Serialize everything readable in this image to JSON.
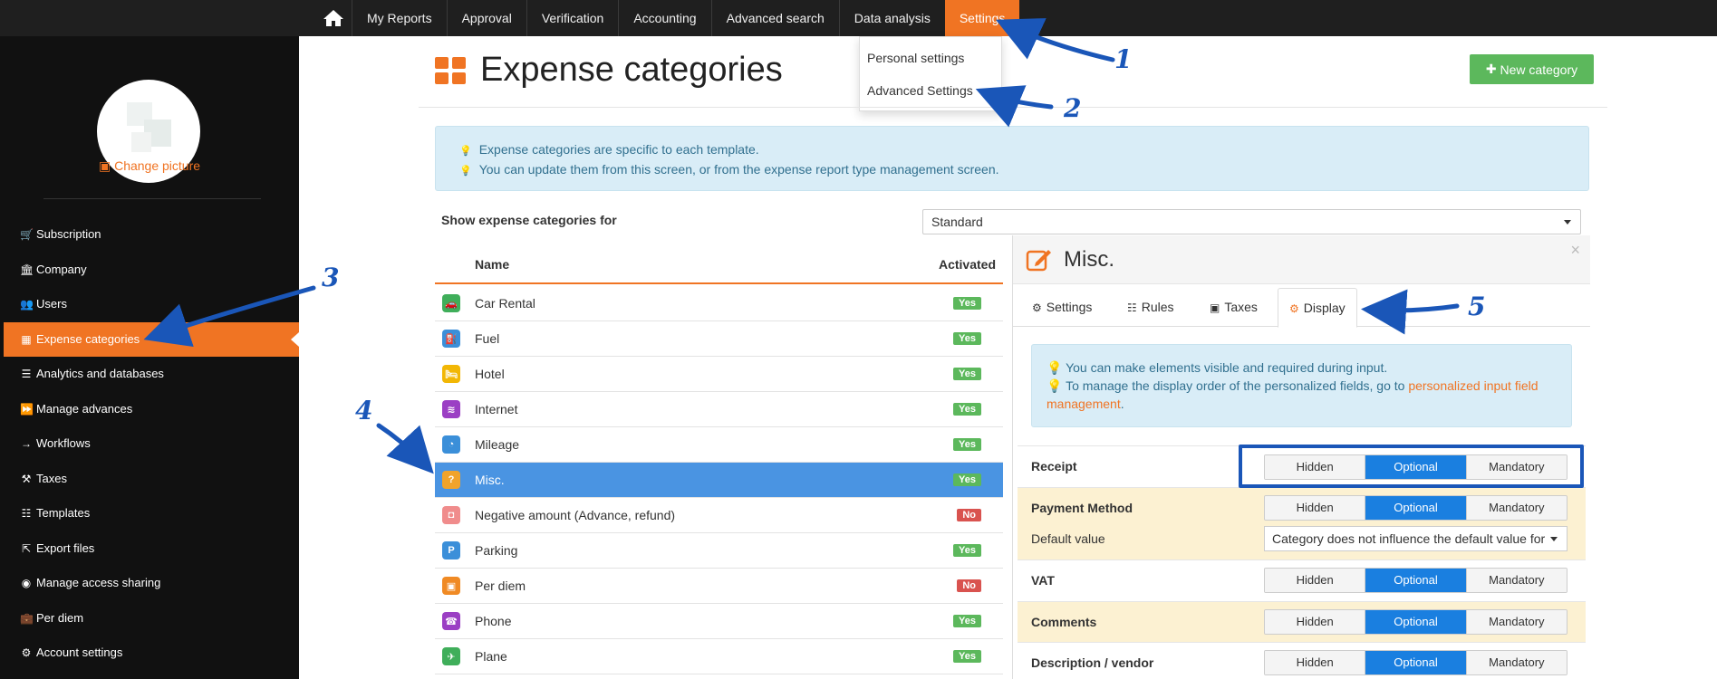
{
  "topnav": {
    "items": [
      "My Reports",
      "Approval",
      "Verification",
      "Accounting",
      "Advanced search",
      "Data analysis",
      "Settings"
    ],
    "active": "Settings",
    "dropdown": [
      "Personal settings",
      "Advanced Settings"
    ]
  },
  "sidebar": {
    "change_picture": "Change picture",
    "items": [
      {
        "label": "Subscription",
        "icon": "cart-icon"
      },
      {
        "label": "Company",
        "icon": "bank-icon"
      },
      {
        "label": "Users",
        "icon": "users-icon"
      },
      {
        "label": "Expense categories",
        "icon": "grid-icon"
      },
      {
        "label": "Analytics and databases",
        "icon": "table-icon"
      },
      {
        "label": "Manage advances",
        "icon": "fast-forward-icon"
      },
      {
        "label": "Workflows",
        "icon": "arrow-right-icon"
      },
      {
        "label": "Taxes",
        "icon": "gavel-icon"
      },
      {
        "label": "Templates",
        "icon": "list-icon"
      },
      {
        "label": "Export files",
        "icon": "export-icon"
      },
      {
        "label": "Manage access sharing",
        "icon": "eye-icon"
      },
      {
        "label": "Per diem",
        "icon": "briefcase-icon"
      },
      {
        "label": "Account settings",
        "icon": "gears-icon"
      }
    ],
    "active": "Expense categories"
  },
  "header": {
    "title": "Expense categories",
    "new_button": "New category"
  },
  "info": {
    "line1": "Expense categories are specific to each template.",
    "line2": "You can update them from this screen, or from the expense report type management screen."
  },
  "filter": {
    "label": "Show expense categories for",
    "value": "Standard"
  },
  "list": {
    "col_name": "Name",
    "col_activated": "Activated",
    "rows": [
      {
        "name": "Car Rental",
        "status": "Yes",
        "color": "#3fae5a",
        "glyph": "🚗"
      },
      {
        "name": "Fuel",
        "status": "Yes",
        "color": "#3b8fd9",
        "glyph": "⛽"
      },
      {
        "name": "Hotel",
        "status": "Yes",
        "color": "#f2b705",
        "glyph": "🛏"
      },
      {
        "name": "Internet",
        "status": "Yes",
        "color": "#9b3fc4",
        "glyph": "≋"
      },
      {
        "name": "Mileage",
        "status": "Yes",
        "color": "#3b8fd9",
        "glyph": "◔"
      },
      {
        "name": "Misc.",
        "status": "Yes",
        "color": "#f0a32a",
        "glyph": "?"
      },
      {
        "name": "Negative amount (Advance, refund)",
        "status": "No",
        "color": "#f08c8c",
        "glyph": "◘"
      },
      {
        "name": "Parking",
        "status": "Yes",
        "color": "#3b8fd9",
        "glyph": "P"
      },
      {
        "name": "Per diem",
        "status": "No",
        "color": "#f08a24",
        "glyph": "▣"
      },
      {
        "name": "Phone",
        "status": "Yes",
        "color": "#9b3fc4",
        "glyph": "☎"
      },
      {
        "name": "Plane",
        "status": "Yes",
        "color": "#3fae5a",
        "glyph": "✈"
      }
    ],
    "selected": "Misc."
  },
  "panel": {
    "title": "Misc.",
    "tabs": [
      "Settings",
      "Rules",
      "Taxes",
      "Display"
    ],
    "active_tab": "Display",
    "info_line1": "You can make elements visible and required during input.",
    "info_line2": "To manage the display order of the personalized fields, go to",
    "info_link": "personalized input field management",
    "info_end": ".",
    "options": [
      "Hidden",
      "Optional",
      "Mandatory"
    ],
    "fields": [
      {
        "label": "Receipt",
        "value": "Optional"
      },
      {
        "label": "Payment Method",
        "value": "Optional"
      },
      {
        "label": "VAT",
        "value": "Optional"
      },
      {
        "label": "Comments",
        "value": "Optional"
      },
      {
        "label": "Description / vendor",
        "value": "Optional"
      }
    ],
    "default_label": "Default value",
    "default_value": "Category does not influence the default value for"
  },
  "annotations": [
    "1",
    "2",
    "3",
    "4",
    "5"
  ]
}
